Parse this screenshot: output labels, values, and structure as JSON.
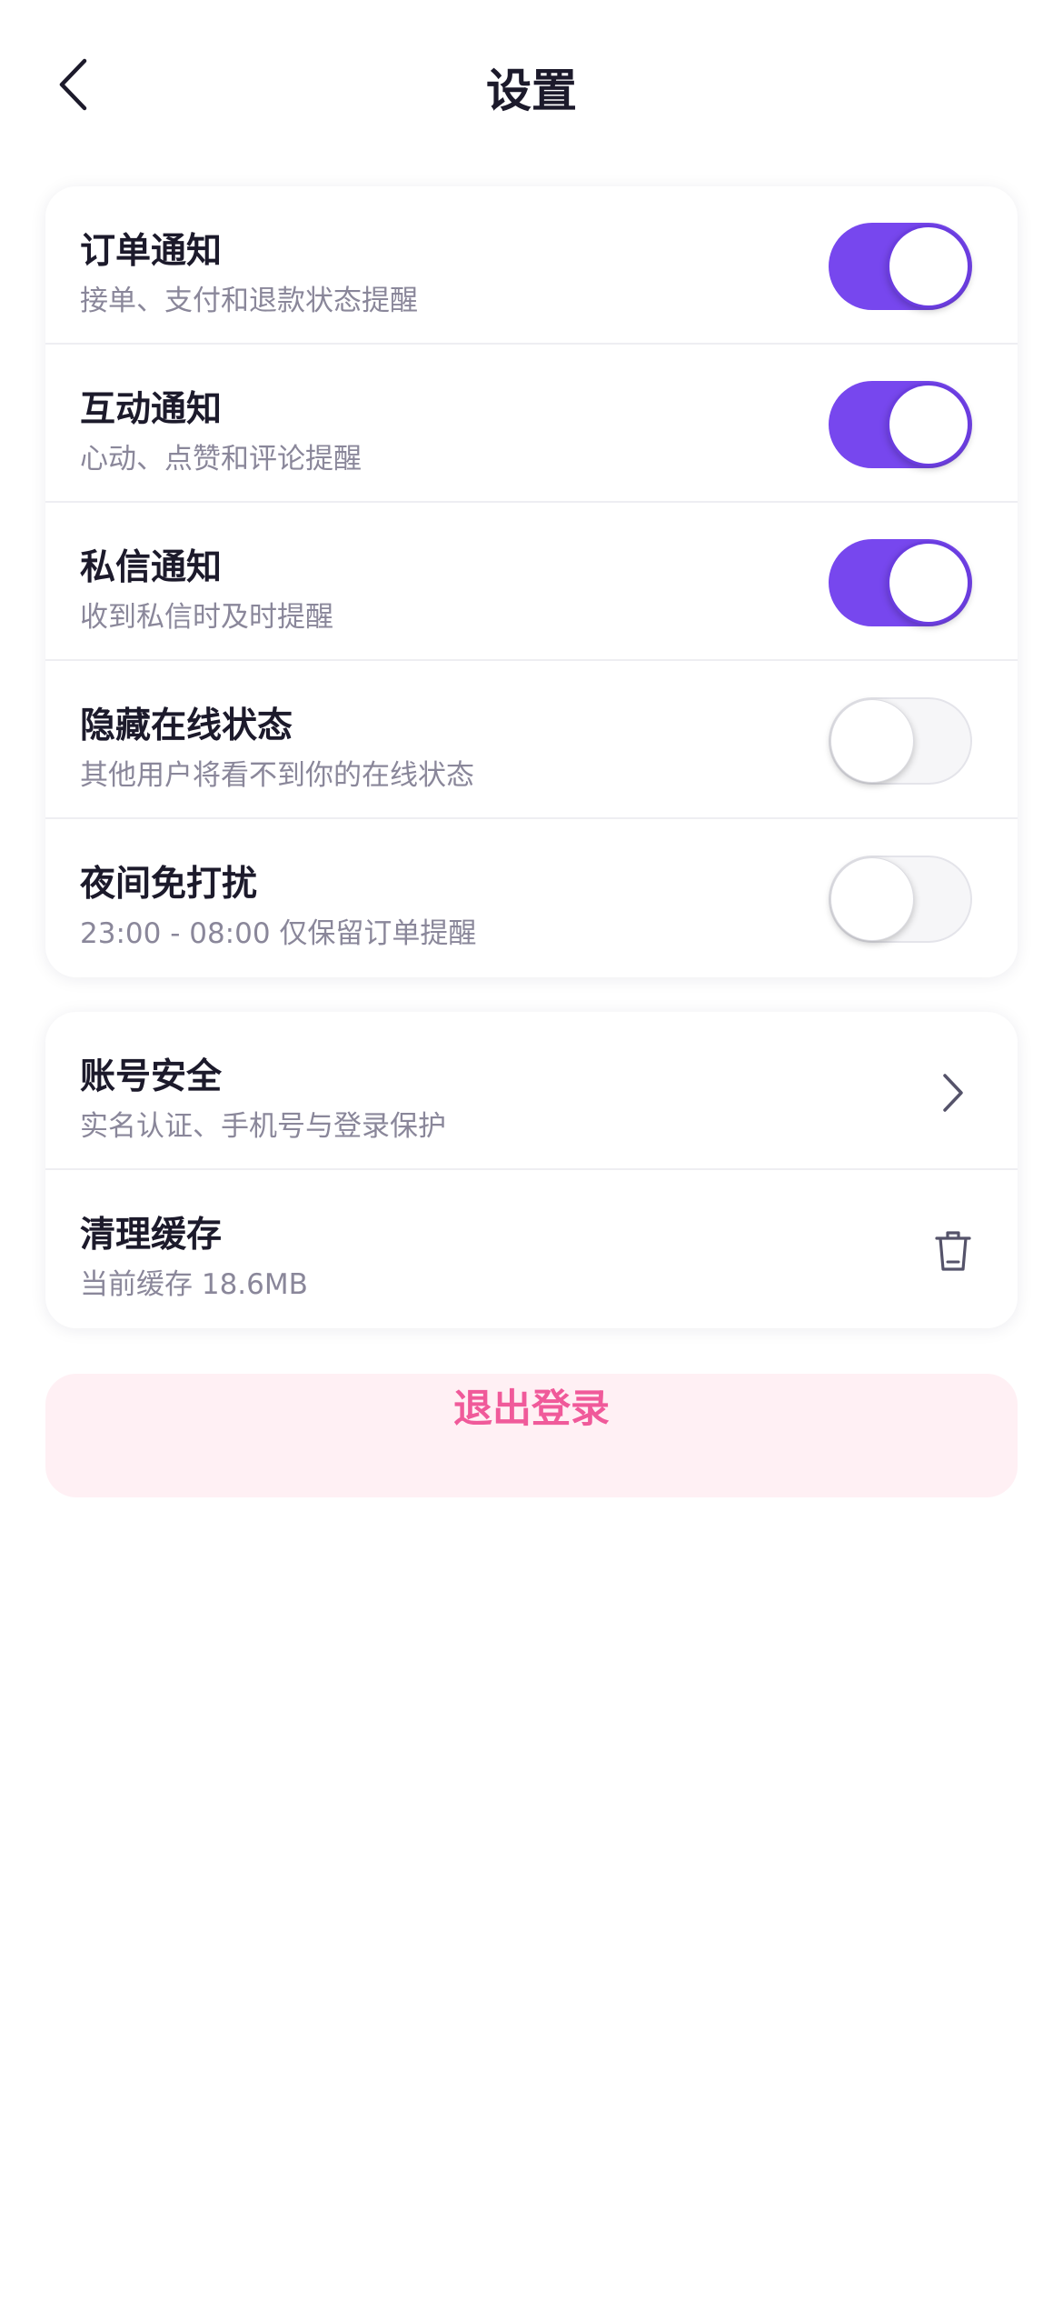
{
  "header": {
    "title": "设置",
    "back_icon": "chevron-left-icon"
  },
  "notifications": [
    {
      "title": "订单通知",
      "subtitle": "接单、支付和退款状态提醒",
      "enabled": true
    },
    {
      "title": "互动通知",
      "subtitle": "心动、点赞和评论提醒",
      "enabled": true
    },
    {
      "title": "私信通知",
      "subtitle": "收到私信时及时提醒",
      "enabled": true
    },
    {
      "title": "隐藏在线状态",
      "subtitle": "其他用户将看不到你的在线状态",
      "enabled": false
    },
    {
      "title": "夜间免打扰",
      "subtitle": "23:00 - 08:00 仅保留订单提醒",
      "enabled": false
    }
  ],
  "account": [
    {
      "title": "账号安全",
      "subtitle": "实名认证、手机号与登录保护",
      "icon": "chevron-right-icon"
    },
    {
      "title": "清理缓存",
      "subtitle": "当前缓存 18.6MB",
      "icon": "trash-icon"
    }
  ],
  "logout": {
    "label": "退出登录"
  },
  "colors": {
    "accent": "#7747ee",
    "danger_text": "#f05a9a",
    "danger_bg": "#fff0f4",
    "muted_text": "#8a879a"
  }
}
